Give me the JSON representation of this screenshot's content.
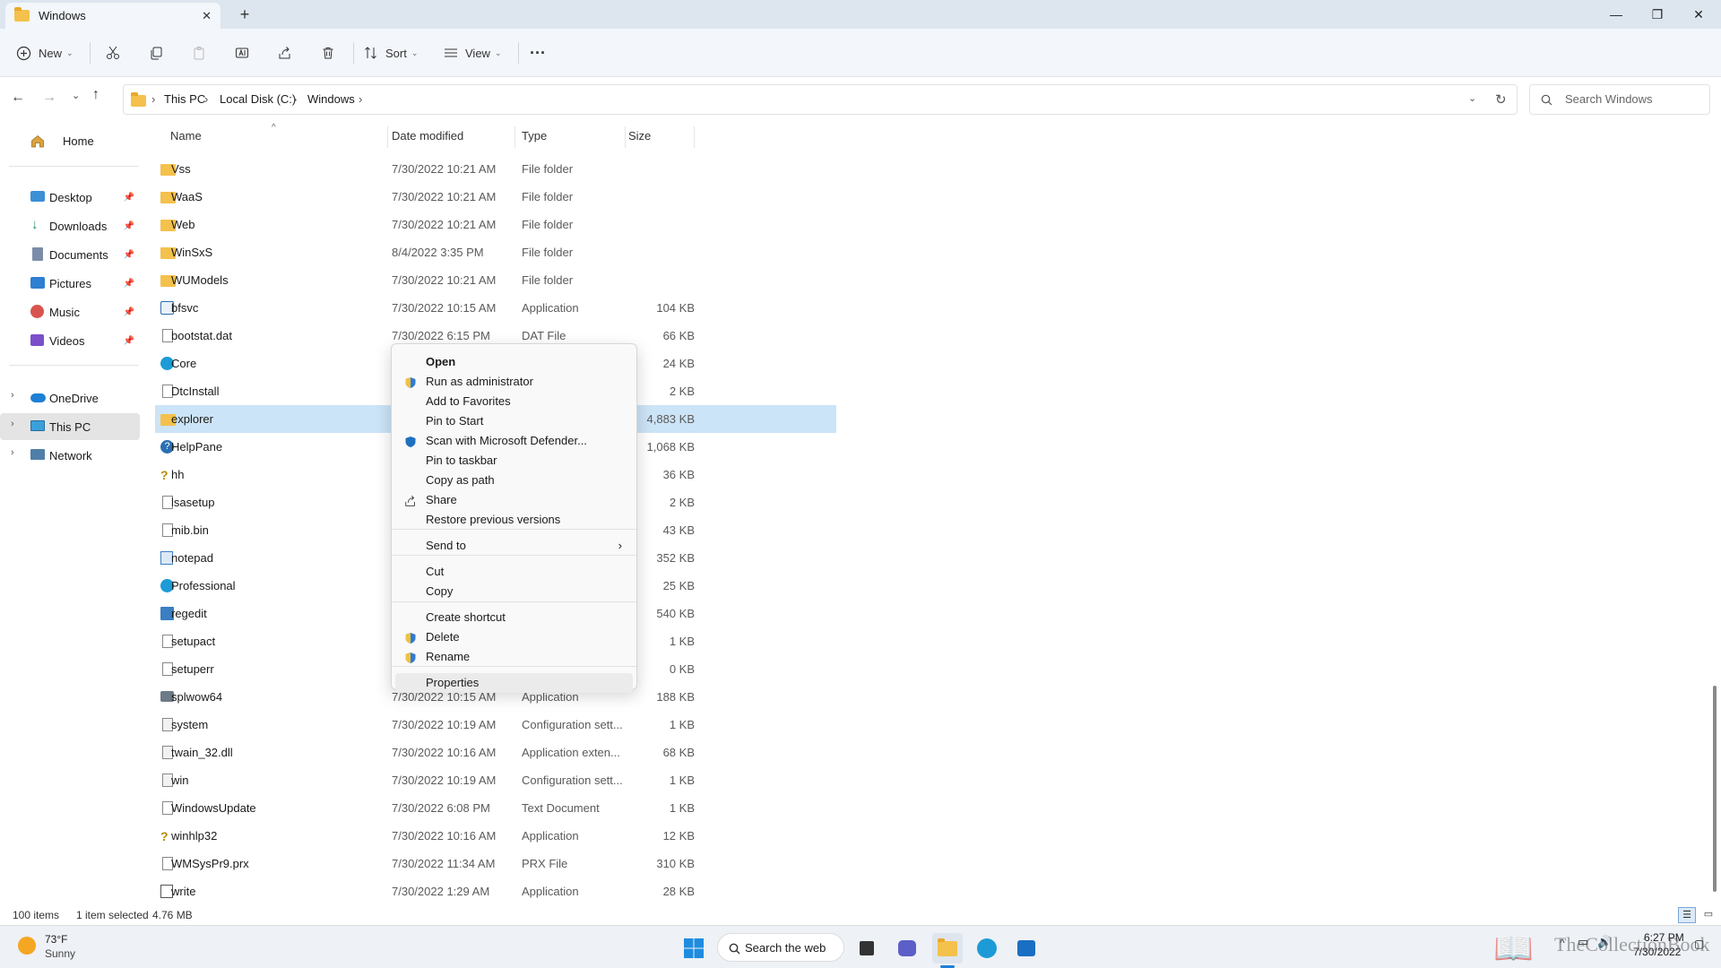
{
  "window": {
    "tab_title": "Windows",
    "new_tab": "+",
    "minimize": "—",
    "maximize": "❐",
    "close": "✕"
  },
  "toolbar": {
    "new_label": "New",
    "sort_label": "Sort",
    "view_label": "View",
    "more": "···"
  },
  "address": {
    "crumbs": [
      "This PC",
      "Local Disk (C:)",
      "Windows"
    ],
    "separator": "›",
    "search_placeholder": "Search Windows"
  },
  "sidebar": {
    "home": "Home",
    "quick": [
      {
        "label": "Desktop",
        "icon": "desktop-icon"
      },
      {
        "label": "Downloads",
        "icon": "download-icon"
      },
      {
        "label": "Documents",
        "icon": "documents-icon"
      },
      {
        "label": "Pictures",
        "icon": "pictures-icon"
      },
      {
        "label": "Music",
        "icon": "music-icon"
      },
      {
        "label": "Videos",
        "icon": "videos-icon"
      }
    ],
    "drives": [
      {
        "label": "OneDrive",
        "icon": "cloud-icon"
      },
      {
        "label": "This PC",
        "icon": "computer-icon"
      },
      {
        "label": "Network",
        "icon": "network-icon"
      }
    ]
  },
  "columns": {
    "name": "Name",
    "date": "Date modified",
    "type": "Type",
    "size": "Size"
  },
  "files": [
    {
      "name": "Vss",
      "date": "7/30/2022 10:21 AM",
      "type": "File folder",
      "size": "",
      "icon": "folder"
    },
    {
      "name": "WaaS",
      "date": "7/30/2022 10:21 AM",
      "type": "File folder",
      "size": "",
      "icon": "folder"
    },
    {
      "name": "Web",
      "date": "7/30/2022 10:21 AM",
      "type": "File folder",
      "size": "",
      "icon": "folder"
    },
    {
      "name": "WinSxS",
      "date": "8/4/2022 3:35 PM",
      "type": "File folder",
      "size": "",
      "icon": "folder"
    },
    {
      "name": "WUModels",
      "date": "7/30/2022 10:21 AM",
      "type": "File folder",
      "size": "",
      "icon": "folder"
    },
    {
      "name": "bfsvc",
      "date": "7/30/2022 10:15 AM",
      "type": "Application",
      "size": "104 KB",
      "icon": "app"
    },
    {
      "name": "bootstat.dat",
      "date": "7/30/2022 6:15 PM",
      "type": "DAT File",
      "size": "66 KB",
      "icon": "file"
    },
    {
      "name": "Core",
      "date": "",
      "type": "",
      "size": "24 KB",
      "icon": "edge"
    },
    {
      "name": "DtcInstall",
      "date": "",
      "type": "",
      "size": "2 KB",
      "icon": "file"
    },
    {
      "name": "explorer",
      "date": "",
      "type": "",
      "size": "4,883 KB",
      "icon": "folder"
    },
    {
      "name": "HelpPane",
      "date": "",
      "type": "",
      "size": "1,068 KB",
      "icon": "help"
    },
    {
      "name": "hh",
      "date": "",
      "type": "",
      "size": "36 KB",
      "icon": "help2"
    },
    {
      "name": "lsasetup",
      "date": "",
      "type": "",
      "size": "2 KB",
      "icon": "file"
    },
    {
      "name": "mib.bin",
      "date": "",
      "type": "",
      "size": "43 KB",
      "icon": "file"
    },
    {
      "name": "notepad",
      "date": "",
      "type": "",
      "size": "352 KB",
      "icon": "notepad"
    },
    {
      "name": "Professional",
      "date": "",
      "type": "",
      "size": "25 KB",
      "icon": "edge"
    },
    {
      "name": "regedit",
      "date": "",
      "type": "",
      "size": "540 KB",
      "icon": "regedit"
    },
    {
      "name": "setupact",
      "date": "",
      "type": "",
      "size": "1 KB",
      "icon": "file"
    },
    {
      "name": "setuperr",
      "date": "",
      "type": "",
      "size": "0 KB",
      "icon": "file"
    },
    {
      "name": "splwow64",
      "date": "7/30/2022 10:15 AM",
      "type": "Application",
      "size": "188 KB",
      "icon": "printer"
    },
    {
      "name": "system",
      "date": "7/30/2022 10:19 AM",
      "type": "Configuration sett...",
      "size": "1 KB",
      "icon": "config"
    },
    {
      "name": "twain_32.dll",
      "date": "7/30/2022 10:16 AM",
      "type": "Application exten...",
      "size": "68 KB",
      "icon": "config"
    },
    {
      "name": "win",
      "date": "7/30/2022 10:19 AM",
      "type": "Configuration sett...",
      "size": "1 KB",
      "icon": "config"
    },
    {
      "name": "WindowsUpdate",
      "date": "7/30/2022 6:08 PM",
      "type": "Text Document",
      "size": "1 KB",
      "icon": "file"
    },
    {
      "name": "winhlp32",
      "date": "7/30/2022 10:16 AM",
      "type": "Application",
      "size": "12 KB",
      "icon": "help2"
    },
    {
      "name": "WMSysPr9.prx",
      "date": "7/30/2022 11:34 AM",
      "type": "PRX File",
      "size": "310 KB",
      "icon": "file"
    },
    {
      "name": "write",
      "date": "7/30/2022 1:29 AM",
      "type": "Application",
      "size": "28 KB",
      "icon": "write"
    }
  ],
  "context_menu": {
    "items": [
      {
        "label": "Open",
        "icon": "",
        "bold": true
      },
      {
        "label": "Run as administrator",
        "icon": "shield"
      },
      {
        "label": "Add to Favorites",
        "icon": ""
      },
      {
        "label": "Pin to Start",
        "icon": ""
      },
      {
        "label": "Scan with Microsoft Defender...",
        "icon": "defender"
      },
      {
        "label": "Pin to taskbar",
        "icon": ""
      },
      {
        "label": "Copy as path",
        "icon": ""
      },
      {
        "label": "Share",
        "icon": "share"
      },
      {
        "label": "Restore previous versions",
        "icon": ""
      },
      {
        "label": "Send to",
        "icon": "",
        "submenu": true
      },
      {
        "label": "Cut",
        "icon": ""
      },
      {
        "label": "Copy",
        "icon": ""
      },
      {
        "label": "Create shortcut",
        "icon": ""
      },
      {
        "label": "Delete",
        "icon": "shield"
      },
      {
        "label": "Rename",
        "icon": "shield"
      },
      {
        "label": "Properties",
        "icon": ""
      }
    ],
    "submenu_arrow": "›"
  },
  "status": {
    "items_count": "100 items",
    "selection": "1 item selected",
    "selection_size": "4.76 MB"
  },
  "taskbar": {
    "weather_temp": "73°F",
    "weather_desc": "Sunny",
    "search_label": "Search the web",
    "time": "6:27 PM",
    "date": "7/30/2022",
    "watermark": "TheCollectionBook"
  }
}
